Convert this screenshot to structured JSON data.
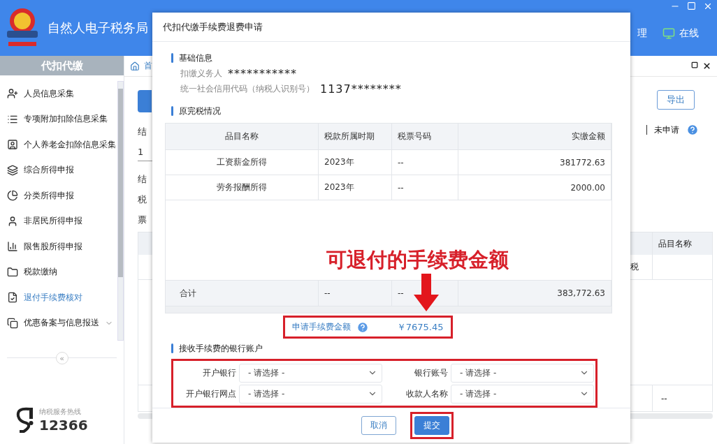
{
  "app": {
    "title": "自然人电子税务局",
    "header_links": [
      {
        "label": "理",
        "kind": "text"
      },
      {
        "label": "在线",
        "kind": "monitor"
      }
    ]
  },
  "sidebar": {
    "title": "代扣代缴",
    "items": [
      {
        "label": "人员信息采集",
        "selected": false,
        "has_submenu": false
      },
      {
        "label": "专项附加扣除信息采集",
        "selected": false,
        "has_submenu": false
      },
      {
        "label": "个人养老金扣除信息采集",
        "selected": false,
        "has_submenu": false
      },
      {
        "label": "综合所得申报",
        "selected": false,
        "has_submenu": false
      },
      {
        "label": "分类所得申报",
        "selected": false,
        "has_submenu": false
      },
      {
        "label": "非居民所得申报",
        "selected": false,
        "has_submenu": false
      },
      {
        "label": "限售股所得申报",
        "selected": false,
        "has_submenu": false
      },
      {
        "label": "税款缴纳",
        "selected": false,
        "has_submenu": false
      },
      {
        "label": "退付手续费核对",
        "selected": true,
        "has_submenu": false
      },
      {
        "label": "优惠备案与信息报送",
        "selected": false,
        "has_submenu": true
      }
    ],
    "collapse": "«",
    "hotline": {
      "label": "纳税服务热线",
      "number": "12366"
    }
  },
  "background": {
    "breadcrumb": "首",
    "left_labels": [
      "结",
      "1",
      "结",
      "税",
      "票"
    ],
    "export_button": "导出",
    "status": "未申请",
    "table_header": "品目名称",
    "cells": [
      "税",
      "--"
    ]
  },
  "dialog": {
    "title": "代扣代缴手续费退费申请",
    "basic": {
      "heading": "基础信息",
      "rows": [
        {
          "label": "扣缴义务人",
          "value": "***********"
        },
        {
          "label": "统一社会信用代码（纳税人识别号）",
          "value": "1137********"
        }
      ]
    },
    "tax": {
      "heading": "原完税情况",
      "columns": [
        "品目名称",
        "税款所属时期",
        "税票号码",
        "实缴金额"
      ],
      "rows": [
        [
          "工资薪金所得",
          "2023年",
          "--",
          "381772.63"
        ],
        [
          "劳务报酬所得",
          "2023年",
          "--",
          "2000.00"
        ]
      ],
      "total": [
        "合计",
        "--",
        "--",
        "383,772.63"
      ]
    },
    "fee": {
      "label": "申请手续费金额",
      "value": "￥7675.45"
    },
    "bank": {
      "heading": "接收手续费的银行账户",
      "fields": [
        {
          "label": "开户银行",
          "placeholder": "- 请选择 -"
        },
        {
          "label": "银行账号",
          "placeholder": "- 请选择 -"
        },
        {
          "label": "开户银行网点",
          "placeholder": "- 请选择 -"
        },
        {
          "label": "收款人名称",
          "placeholder": "- 请选择 -"
        }
      ]
    },
    "buttons": [
      {
        "label": "取消",
        "kind": "secondary"
      },
      {
        "label": "提交",
        "kind": "primary"
      }
    ]
  },
  "annotation": {
    "caption": "可退付的手续费金额"
  }
}
